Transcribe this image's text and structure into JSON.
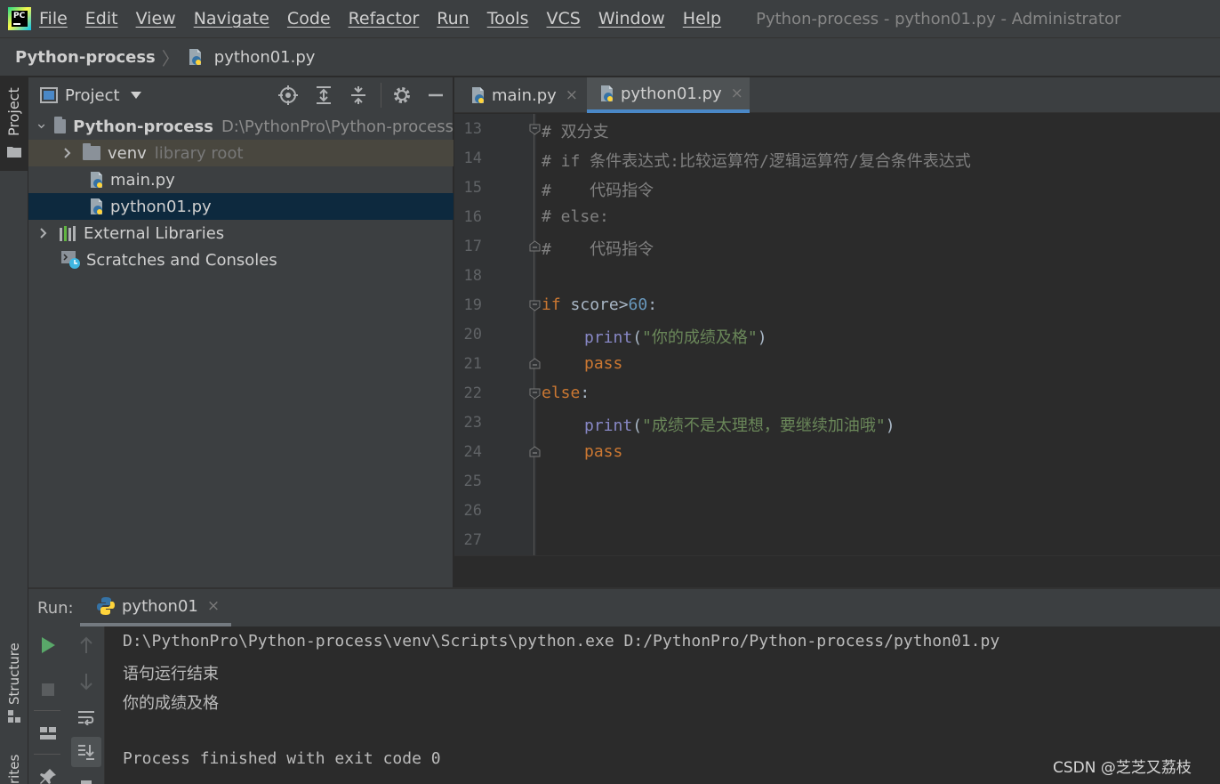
{
  "menubar": {
    "items": [
      "File",
      "Edit",
      "View",
      "Navigate",
      "Code",
      "Refactor",
      "Run",
      "Tools",
      "VCS",
      "Window",
      "Help"
    ],
    "window_title": "Python-process - python01.py - Administrator",
    "logo_text": "PC"
  },
  "breadcrumb": {
    "project": "Python-process",
    "file": "python01.py"
  },
  "left_stripe": {
    "project": "Project",
    "structure": "Structure",
    "favorites": "rites"
  },
  "project_panel": {
    "title": "Project",
    "tree": {
      "root_name": "Python-process",
      "root_path": "D:\\PythonPro\\Python-process",
      "venv": "venv",
      "venv_note": "library root",
      "file1": "main.py",
      "file2": "python01.py",
      "external": "External Libraries",
      "scratches": "Scratches and Consoles"
    }
  },
  "editor_tabs": {
    "tab1": "main.py",
    "tab2": "python01.py",
    "close": "×"
  },
  "editor": {
    "line_numbers": [
      "13",
      "14",
      "15",
      "16",
      "17",
      "18",
      "19",
      "20",
      "21",
      "22",
      "23",
      "24",
      "25",
      "26",
      "27"
    ],
    "l13": "# 双分支",
    "l14": "# if 条件表达式:比较运算符/逻辑运算符/复合条件表达式",
    "l15": "#    代码指令",
    "l16": "# else:",
    "l17": "#    代码指令",
    "l19_kw": "if",
    "l19_mid": " score>",
    "l19_num": "60",
    "l19_end": ":",
    "l20_fn": "print",
    "l20_open": "(",
    "l20_str": "\"你的成绩及格\"",
    "l20_close": ")",
    "l21": "pass",
    "l22_kw": "else",
    "l22_end": ":",
    "l23_fn": "print",
    "l23_open": "(",
    "l23_str": "\"成绩不是太理想，要继续加油哦\"",
    "l23_close": ")",
    "l24": "pass"
  },
  "run_panel": {
    "label": "Run:",
    "tab": "python01",
    "close": "×",
    "console": {
      "line1": "D:\\PythonPro\\Python-process\\venv\\Scripts\\python.exe D:/PythonPro/Python-process/python01.py",
      "line2": "语句运行结束",
      "line3": "你的成绩及格",
      "line5": "Process finished with exit code 0"
    }
  },
  "watermark": "CSDN @芝芝又荔枝"
}
